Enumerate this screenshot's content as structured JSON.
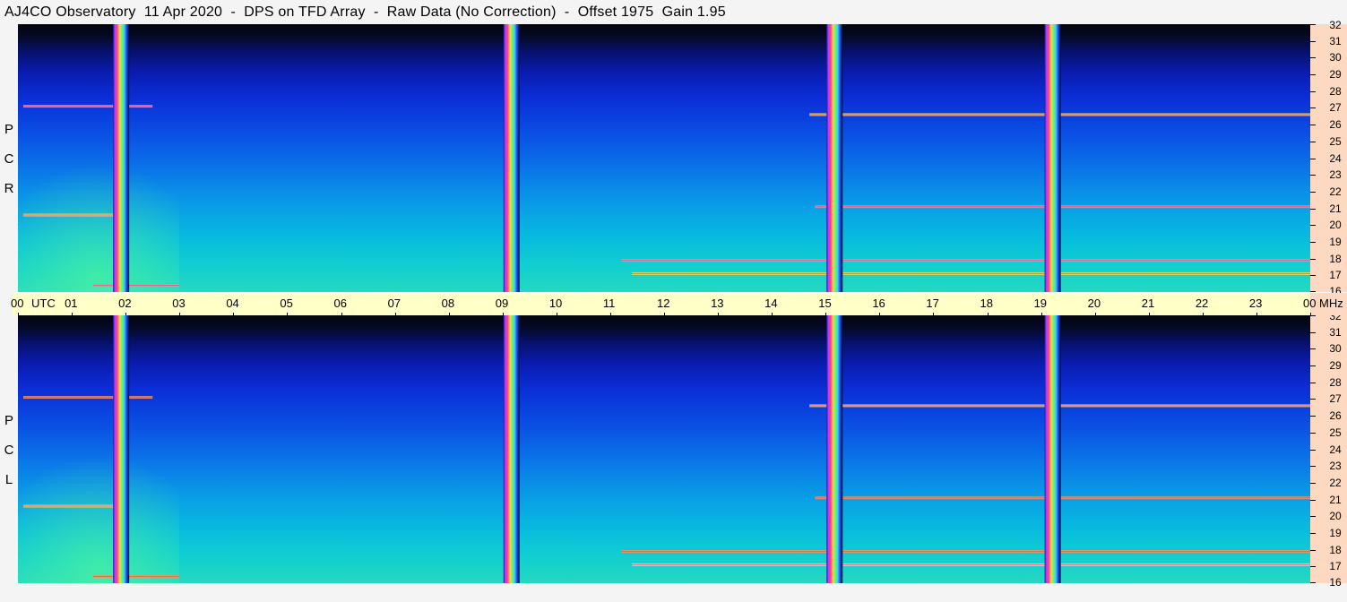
{
  "title": "AJ4CO Observatory  11 Apr 2020  -  DPS on TFD Array  -  Raw Data (No Correction)  -  Offset 1975  Gain 1.95",
  "panels": [
    {
      "id": "rcp",
      "letters": [
        "P",
        "C",
        "R"
      ]
    },
    {
      "id": "lcp",
      "letters": [
        "P",
        "C",
        "L"
      ]
    }
  ],
  "time_axis": {
    "labels": [
      "00",
      "01",
      "02",
      "03",
      "04",
      "05",
      "06",
      "07",
      "08",
      "09",
      "10",
      "11",
      "12",
      "13",
      "14",
      "15",
      "16",
      "17",
      "18",
      "19",
      "20",
      "21",
      "22",
      "23",
      "00"
    ],
    "utc_label": "UTC",
    "freq_unit": "MHz"
  },
  "colors": {
    "freq_axis_bg": "#fcd9c0",
    "time_axis_bg": "#ffffc8",
    "palette_low": "#03040c",
    "palette_mid": "#0a52e4",
    "palette_high": "#25d8c0"
  },
  "chart_data": {
    "type": "heatmap",
    "title": "AJ4CO Observatory  11 Apr 2020  -  DPS on TFD Array  -  Raw Data (No Correction)  -  Offset 1975  Gain 1.95",
    "x_axis": {
      "label": "UTC",
      "range_hours": [
        0,
        24
      ],
      "ticks": [
        "00",
        "01",
        "02",
        "03",
        "04",
        "05",
        "06",
        "07",
        "08",
        "09",
        "10",
        "11",
        "12",
        "13",
        "14",
        "15",
        "16",
        "17",
        "18",
        "19",
        "20",
        "21",
        "22",
        "23",
        "00"
      ]
    },
    "y_axis": {
      "label": "MHz",
      "range": [
        16,
        32
      ],
      "ticks": [
        16,
        17,
        18,
        19,
        20,
        21,
        22,
        23,
        24,
        25,
        26,
        27,
        28,
        29,
        30,
        31,
        32
      ]
    },
    "series": [
      {
        "name": "RCP"
      },
      {
        "name": "LCP"
      }
    ],
    "calibration_bursts_utc": [
      1.9,
      9.15,
      15.15,
      19.2
    ],
    "interference_bands_mhz": [
      {
        "freq": 27.1,
        "start": 0.1,
        "end": 2.5
      },
      {
        "freq": 26.6,
        "start": 14.7,
        "end": 24.0
      },
      {
        "freq": 21.1,
        "start": 14.8,
        "end": 24.0
      },
      {
        "freq": 20.6,
        "start": 0.1,
        "end": 1.8
      },
      {
        "freq": 17.9,
        "start": 11.2,
        "end": 24.0
      },
      {
        "freq": 17.1,
        "start": 11.4,
        "end": 24.0
      },
      {
        "freq": 16.4,
        "start": 1.4,
        "end": 3.0
      }
    ],
    "palette": "rainbow"
  }
}
